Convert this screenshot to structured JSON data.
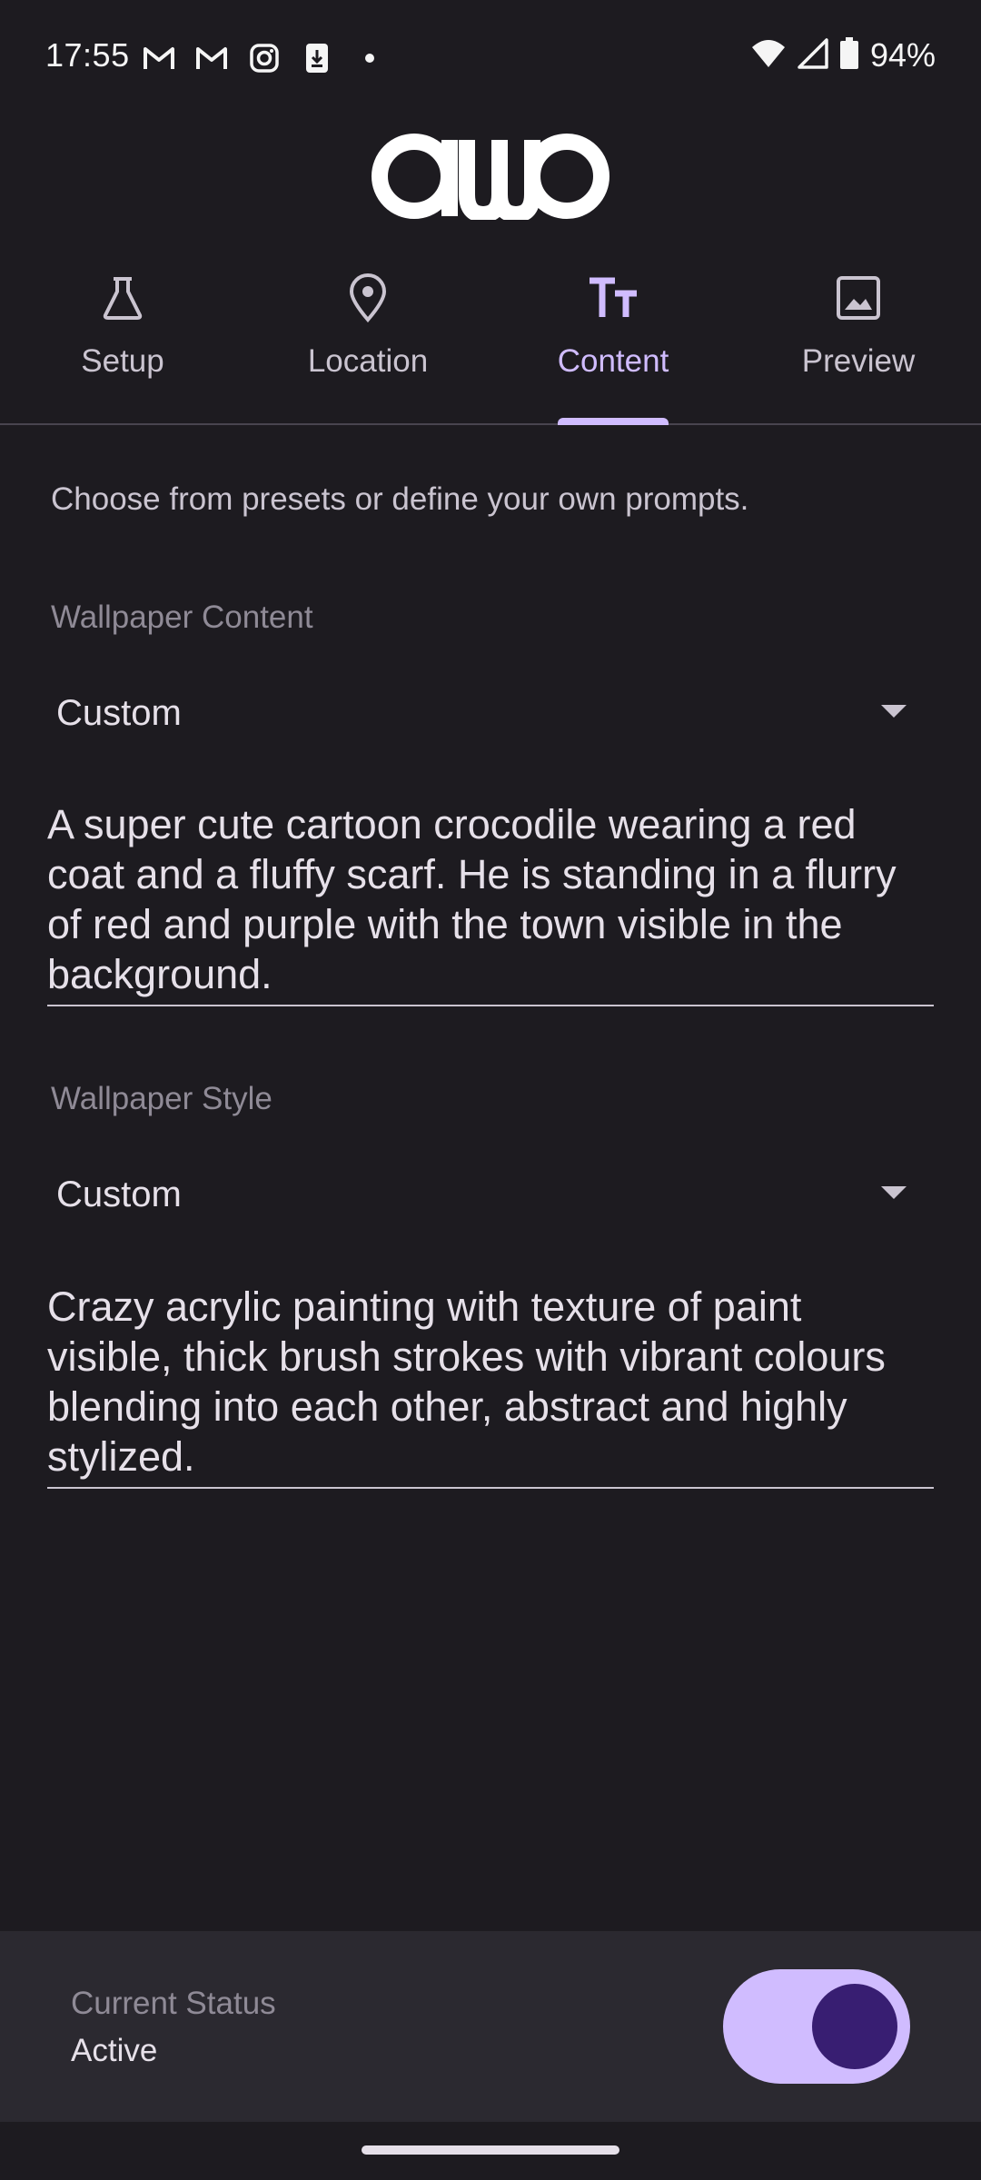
{
  "status_bar": {
    "time": "17:55",
    "notification_icons": [
      "gmail-icon",
      "gmail-icon",
      "instagram-icon",
      "download-icon",
      "dot-icon"
    ],
    "battery": "94%"
  },
  "tabs": [
    {
      "label": "Setup",
      "icon": "flask-icon",
      "active": false
    },
    {
      "label": "Location",
      "icon": "location-pin-icon",
      "active": false
    },
    {
      "label": "Content",
      "icon": "text-icon",
      "active": true
    },
    {
      "label": "Preview",
      "icon": "image-icon",
      "active": false
    }
  ],
  "content": {
    "intro": "Choose from presets or define your own prompts.",
    "wallpaper_content": {
      "label": "Wallpaper Content",
      "selected": "Custom",
      "prompt": "A super cute cartoon crocodile wearing a red coat and a fluffy scarf. He is standing in a flurry of red and purple with the town visible in the background."
    },
    "wallpaper_style": {
      "label": "Wallpaper Style",
      "selected": "Custom",
      "prompt": "Crazy acrylic painting with texture of paint visible, thick brush strokes with vibrant colours blending into each other, abstract and highly stylized."
    }
  },
  "current_status": {
    "title": "Current Status",
    "value": "Active",
    "toggle_on": true
  },
  "colors": {
    "background": "#1d1b20",
    "accent": "#d0bcff",
    "panel": "#2b2930"
  }
}
